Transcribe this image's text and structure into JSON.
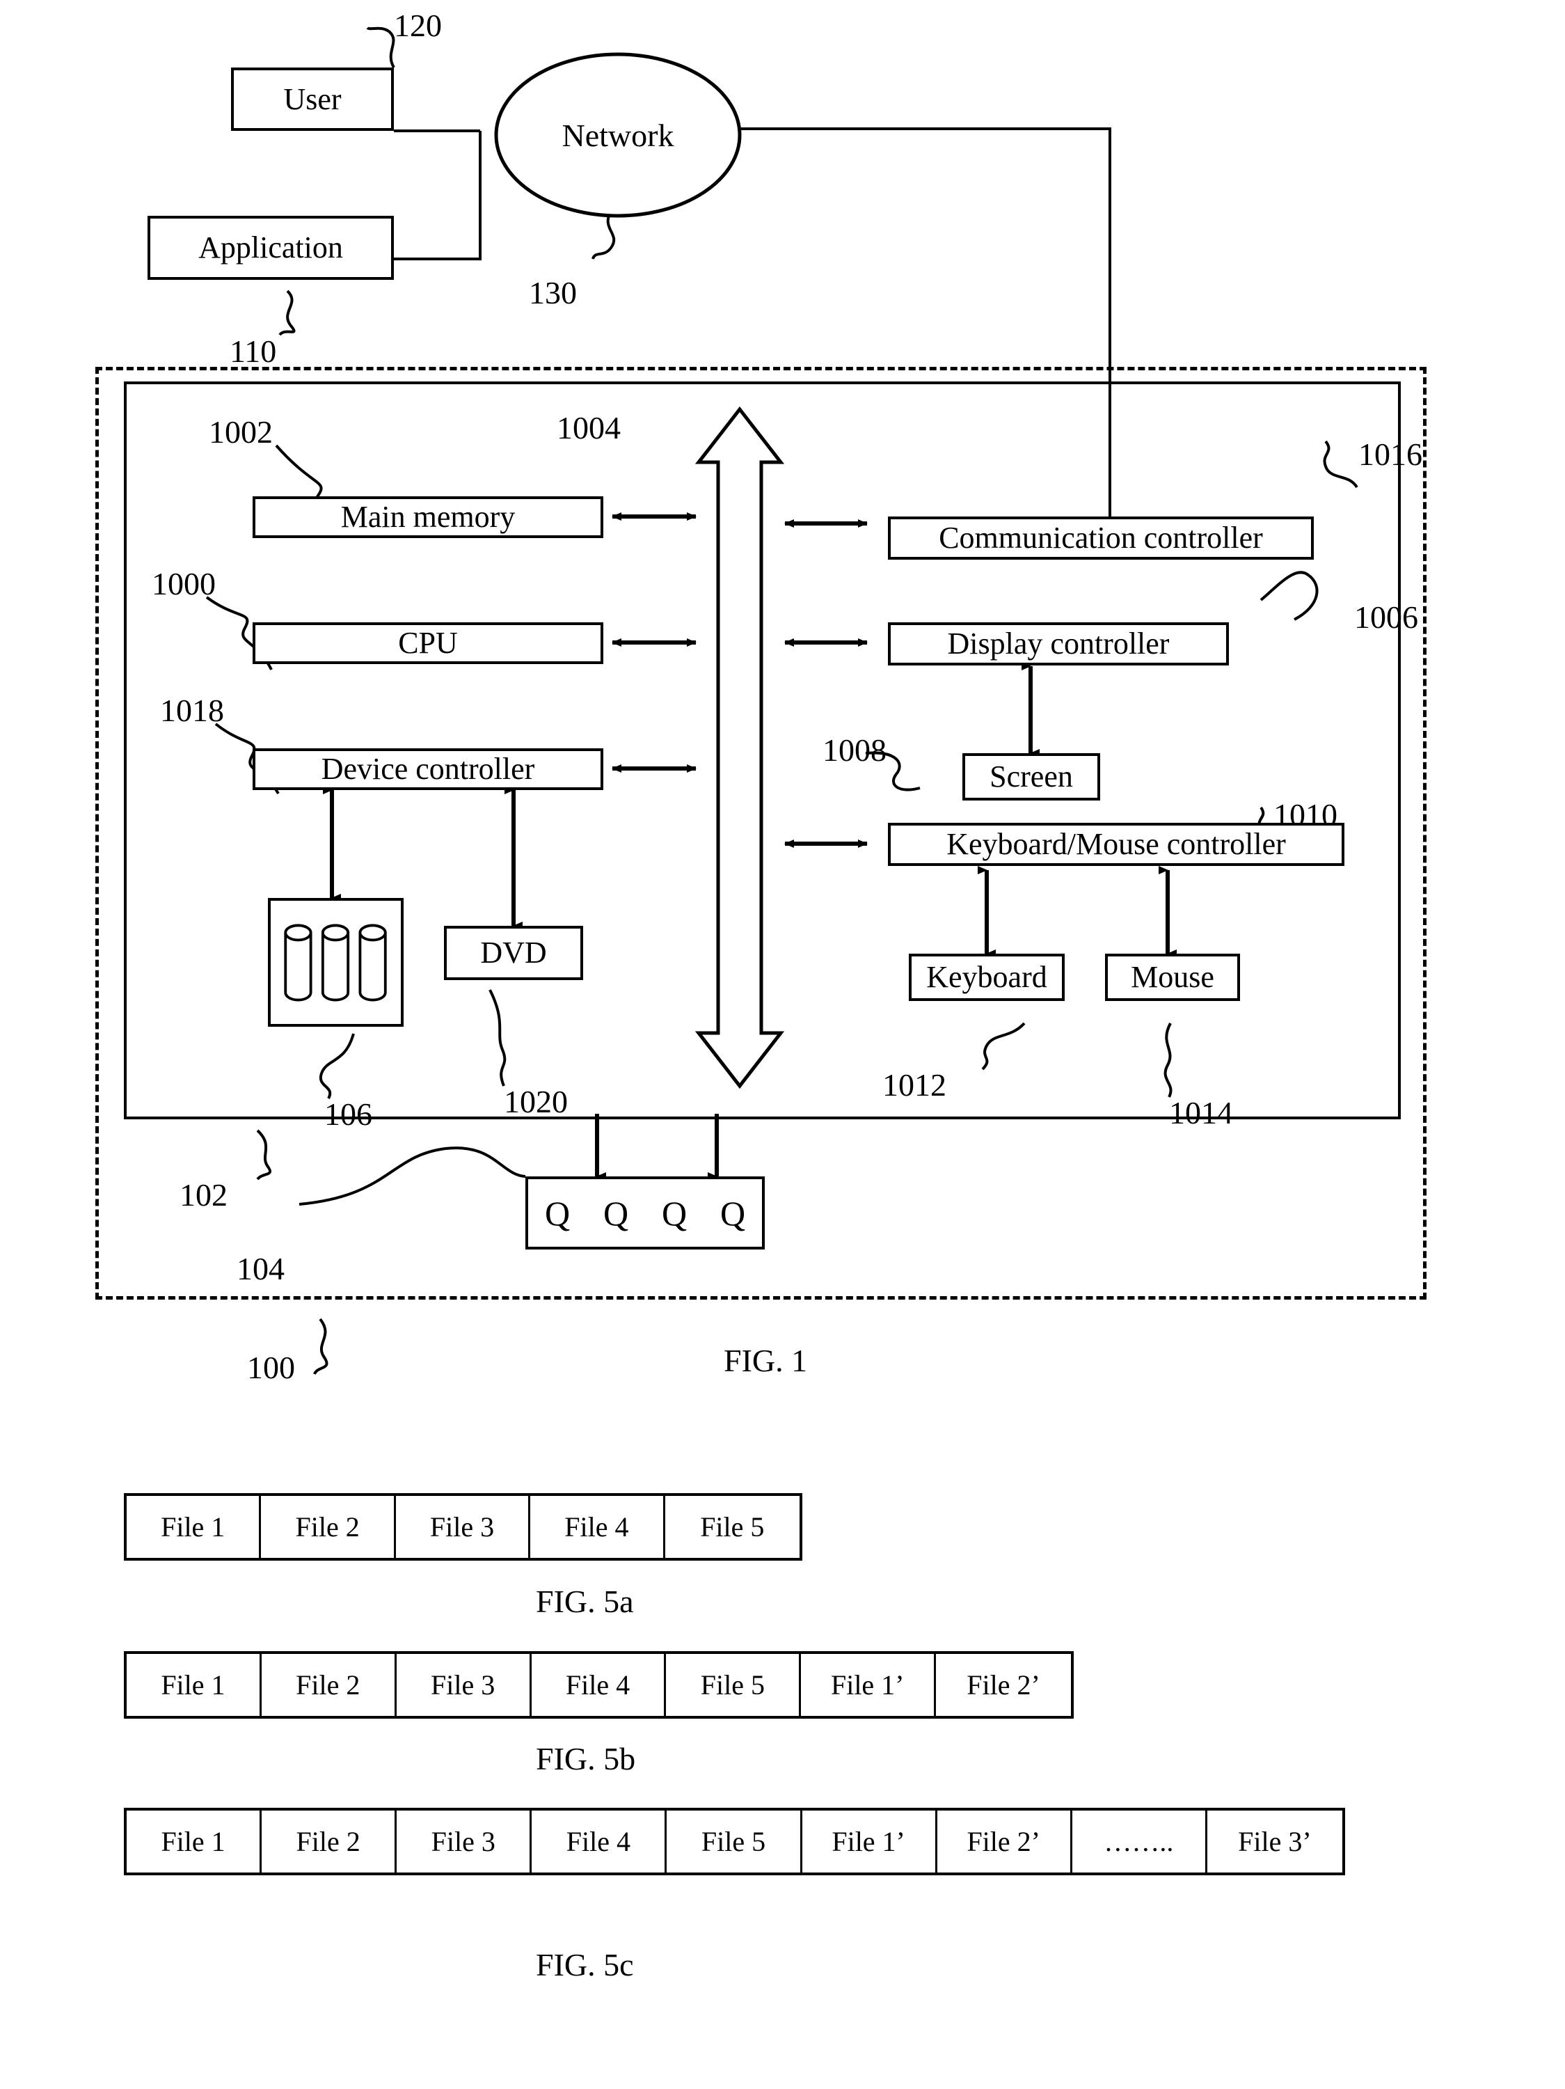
{
  "figure1": {
    "caption": "FIG. 1",
    "external_nodes": [
      {
        "id": "user",
        "label": "User",
        "ref": "120"
      },
      {
        "id": "application",
        "label": "Application",
        "ref": "110"
      },
      {
        "id": "network",
        "label": "Network",
        "ref": "130"
      }
    ],
    "machine": {
      "ref_outer": "100",
      "ref_inner": "102",
      "ref_group": "1000"
    },
    "components": [
      {
        "id": "main-memory",
        "label": "Main memory",
        "ref": "1002"
      },
      {
        "id": "cpu",
        "label": "CPU",
        "ref": "1000"
      },
      {
        "id": "device-controller",
        "label": "Device controller",
        "ref": "1018"
      },
      {
        "id": "bus",
        "label": "",
        "ref": "1004"
      },
      {
        "id": "communication-controller",
        "label": "Communication controller",
        "ref": "1016"
      },
      {
        "id": "display-controller",
        "label": "Display controller",
        "ref": "1006"
      },
      {
        "id": "screen",
        "label": "Screen",
        "ref": "1008"
      },
      {
        "id": "keyboard-mouse-controller",
        "label": "Keyboard/Mouse controller",
        "ref": "1010"
      },
      {
        "id": "keyboard",
        "label": "Keyboard",
        "ref": "1012"
      },
      {
        "id": "mouse",
        "label": "Mouse",
        "ref": "1014"
      },
      {
        "id": "disk-array",
        "label": "",
        "ref": "106"
      },
      {
        "id": "dvd",
        "label": "DVD",
        "ref": "1020"
      },
      {
        "id": "queue-device",
        "label": "",
        "ref": "104"
      }
    ],
    "labels": {
      "user": "User",
      "application": "Application",
      "network": "Network",
      "main_memory": "Main memory",
      "cpu": "CPU",
      "device_controller": "Device controller",
      "dvd": "DVD",
      "communication_controller": "Communication controller",
      "display_controller": "Display controller",
      "screen": "Screen",
      "keyboard_mouse_controller": "Keyboard/Mouse controller",
      "keyboard": "Keyboard",
      "mouse": "Mouse"
    },
    "refs": {
      "r100": "100",
      "r102": "102",
      "r104": "104",
      "r106": "106",
      "r110": "110",
      "r120": "120",
      "r130": "130",
      "r1000": "1000",
      "r1002": "1002",
      "r1004": "1004",
      "r1006": "1006",
      "r1008": "1008",
      "r1010": "1010",
      "r1012": "1012",
      "r1014": "1014",
      "r1016": "1016",
      "r1018": "1018",
      "r1020": "1020"
    },
    "queue_glyphs": [
      "Q",
      "Q",
      "Q",
      "Q"
    ]
  },
  "figure5a": {
    "caption": "FIG. 5a",
    "cells": [
      "File 1",
      "File 2",
      "File 3",
      "File 4",
      "File 5"
    ]
  },
  "figure5b": {
    "caption": "FIG. 5b",
    "cells": [
      "File 1",
      "File 2",
      "File 3",
      "File 4",
      "File 5",
      "File 1’",
      "File 2’"
    ]
  },
  "figure5c": {
    "caption": "FIG. 5c",
    "cells": [
      "File 1",
      "File 2",
      "File 3",
      "File 4",
      "File 5",
      "File 1’",
      "File 2’",
      "……..",
      "File 3’"
    ]
  },
  "colors": {
    "ink": "#000000",
    "paper": "#ffffff"
  }
}
